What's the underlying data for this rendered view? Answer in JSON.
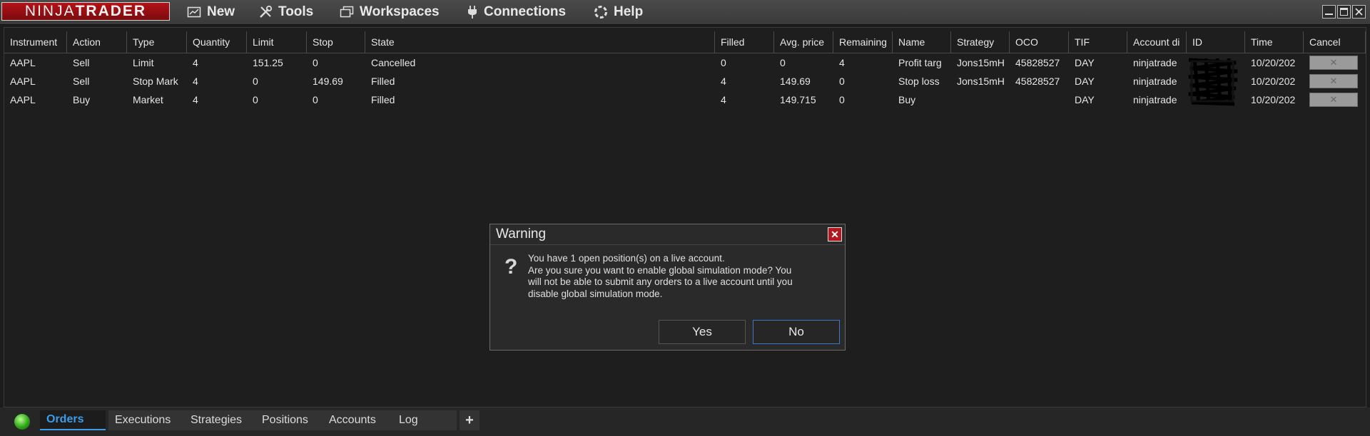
{
  "logo": {
    "part1": "NINJA",
    "part2": "TRADER"
  },
  "menu": {
    "new": "New",
    "tools": "Tools",
    "workspaces": "Workspaces",
    "connections": "Connections",
    "help": "Help"
  },
  "grid": {
    "columns": [
      "Instrument",
      "Action",
      "Type",
      "Quantity",
      "Limit",
      "Stop",
      "State",
      "Filled",
      "Avg. price",
      "Remaining",
      "Name",
      "Strategy",
      "OCO",
      "TIF",
      "Account di",
      "ID",
      "Time",
      "Cancel"
    ],
    "rows": [
      {
        "instrument": "AAPL",
        "action": "Sell",
        "type": "Limit",
        "quantity": "4",
        "limit": "151.25",
        "stop": "0",
        "state": "Cancelled",
        "filled": "0",
        "avg_price": "0",
        "remaining": "4",
        "name": "Profit targ",
        "strategy": "Jons15mH",
        "oco": "45828527",
        "tif": "DAY",
        "account": "ninjatrade",
        "id": "",
        "time": "10/20/202",
        "cancel": "✕"
      },
      {
        "instrument": "AAPL",
        "action": "Sell",
        "type": "Stop Mark",
        "quantity": "4",
        "limit": "0",
        "stop": "149.69",
        "state": "Filled",
        "filled": "4",
        "avg_price": "149.69",
        "remaining": "0",
        "name": "Stop loss",
        "strategy": "Jons15mH",
        "oco": "45828527",
        "tif": "DAY",
        "account": "ninjatrade",
        "id": "",
        "time": "10/20/202",
        "cancel": "✕"
      },
      {
        "instrument": "AAPL",
        "action": "Buy",
        "type": "Market",
        "quantity": "4",
        "limit": "0",
        "stop": "0",
        "state": "Filled",
        "filled": "4",
        "avg_price": "149.715",
        "remaining": "0",
        "name": "Buy",
        "strategy": "",
        "oco": "",
        "tif": "DAY",
        "account": "ninjatrade",
        "id": "",
        "time": "10/20/202",
        "cancel": "✕"
      }
    ]
  },
  "dialog": {
    "title": "Warning",
    "close": "✕",
    "icon": "question-icon",
    "lines": [
      "You have 1 open position(s) on a live account.",
      "Are you sure you want to enable global simulation mode?  You",
      "will not be able to submit any orders to a live account until you",
      "disable global simulation mode."
    ],
    "yes": "Yes",
    "no": "No"
  },
  "tabs": [
    "Orders",
    "Executions",
    "Strategies",
    "Positions",
    "Accounts",
    "Log"
  ],
  "tab_add": "+",
  "active_tab": "Orders",
  "colors": {
    "logo_red": "#b31217",
    "active_tab": "#3d9be9",
    "status": "#2fa51a"
  }
}
